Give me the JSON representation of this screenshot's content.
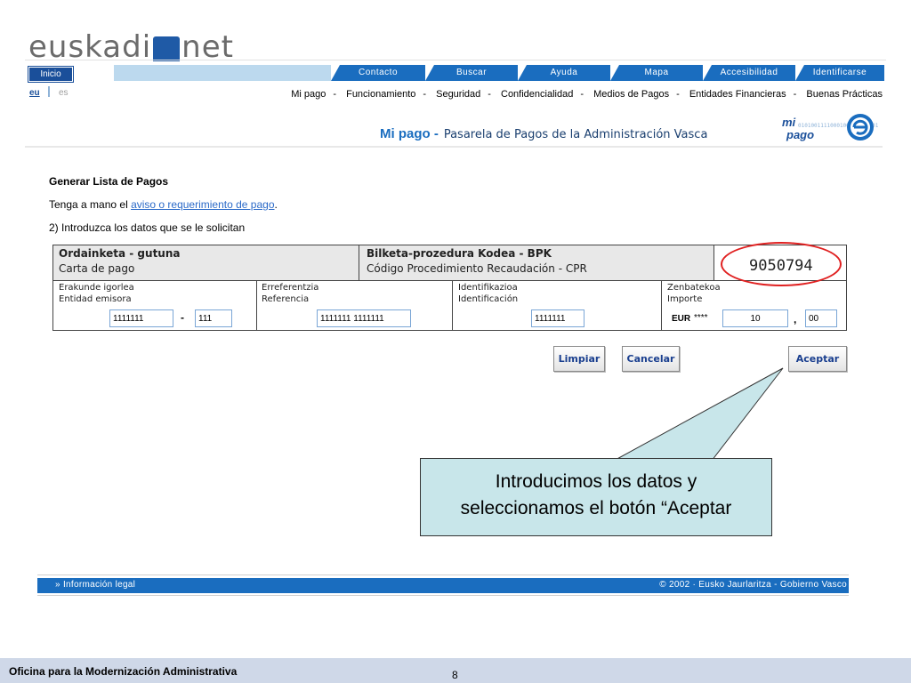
{
  "header": {
    "logo_left": "euskadi",
    "logo_right": "net",
    "nav": {
      "inicio": "Inicio",
      "tabs": [
        "Contacto",
        "Buscar",
        "Ayuda",
        "Mapa",
        "Accesibilidad",
        "Identificarse"
      ]
    },
    "lang": {
      "eu": "eu",
      "es": "es"
    },
    "links": [
      "Mi pago",
      "Funcionamiento",
      "Seguridad",
      "Confidencialidad",
      "Medios de Pagos",
      "Entidades Financieras",
      "Buenas Prácticas"
    ],
    "link_separator": "-"
  },
  "subheader": {
    "title_prefix": "Mi pago -",
    "title": "Pasarela de Pagos de la Administración Vasca",
    "logo_mi": "mi",
    "logo_pago": "pago",
    "logo_e": "e",
    "logo_binary": "0101001111000100110011101011101100101111110000000101"
  },
  "content": {
    "heading": "Generar Lista de Pagos",
    "line1_prefix": "Tenga a mano el ",
    "line1_link": "aviso o requerimiento de pago",
    "line1_suffix": ".",
    "line2": "2)  Introduzca los datos que se le solicitan"
  },
  "form": {
    "doc_eu": "Ordainketa - gutuna",
    "doc_es": "Carta de pago",
    "cpr_eu": "Bilketa-prozedura Kodea - BPK",
    "cpr_es": "Código Procedimiento Recaudación - CPR",
    "cpr_value": "9050794",
    "entity_eu": "Erakunde igorlea",
    "entity_es": "Entidad emisora",
    "entity_value1": "1111111",
    "entity_dash": "-",
    "entity_value2": "111",
    "ref_eu": "Erreferentzia",
    "ref_es": "Referencia",
    "ref_value": "1111111 1111111",
    "id_eu": "Identifikazioa",
    "id_es": "Identificación",
    "id_value": "1111111",
    "amount_eu": "Zenbatekoa",
    "amount_es": "Importe",
    "currency": "EUR",
    "stars": "****",
    "amount_int": "10",
    "comma": ",",
    "amount_dec": "00"
  },
  "buttons": {
    "clear": "Limpiar",
    "cancel": "Cancelar",
    "accept": "Aceptar"
  },
  "callout": {
    "line1": "Introducimos los datos y",
    "line2": "seleccionamos el botón “Aceptar"
  },
  "footer": {
    "legal": "» Información legal",
    "copyright": "© 2002 · Eusko Jaurlaritza - Gobierno Vasco"
  },
  "slide": {
    "office": "Oficina para la Modernización Administrativa",
    "page_number": "8"
  },
  "colors": {
    "nav_blue": "#1a6dbf",
    "highlight_red": "#e02020",
    "callout_bg": "#c8e6ea"
  }
}
